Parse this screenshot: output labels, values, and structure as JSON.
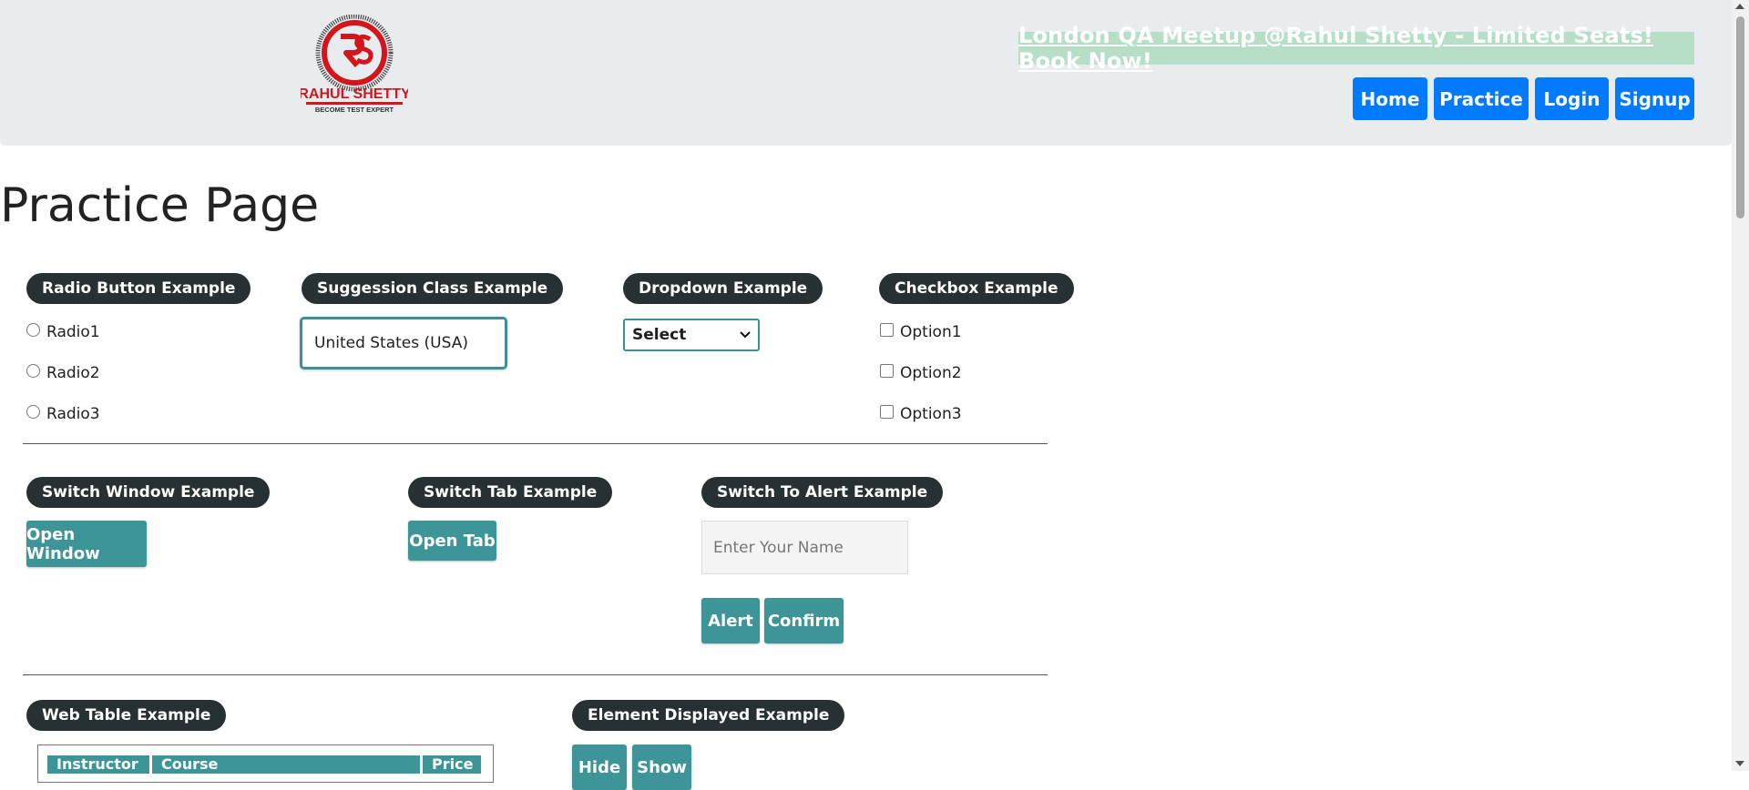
{
  "header": {
    "logo_text": "RAHUL SHETTY",
    "logo_tagline": "BECOME TEST EXPERT",
    "promo": "London QA Meetup @Rahul Shetty - Limited Seats! Book Now!",
    "nav": [
      "Home",
      "Practice",
      "Login",
      "Signup"
    ]
  },
  "page_title": "Practice Page",
  "radio": {
    "legend": "Radio Button Example",
    "options": [
      "Radio1",
      "Radio2",
      "Radio3"
    ]
  },
  "suggestion": {
    "legend": "Suggession Class Example",
    "value": "United States (USA)"
  },
  "dropdown": {
    "legend": "Dropdown Example",
    "selected": "Select"
  },
  "checkbox": {
    "legend": "Checkbox Example",
    "options": [
      "Option1",
      "Option2",
      "Option3"
    ]
  },
  "switch_window": {
    "legend": "Switch Window Example",
    "button": "Open Window"
  },
  "switch_tab": {
    "legend": "Switch Tab Example",
    "button": "Open Tab"
  },
  "alert": {
    "legend": "Switch To Alert Example",
    "placeholder": "Enter Your Name",
    "alert_button": "Alert",
    "confirm_button": "Confirm"
  },
  "web_table": {
    "legend": "Web Table Example",
    "headers": [
      "Instructor",
      "Course",
      "Price"
    ]
  },
  "element_displayed": {
    "legend": "Element Displayed Example",
    "hide_button": "Hide",
    "show_button": "Show"
  },
  "colors": {
    "nav_blue": "#007bff",
    "teal": "#3d9598",
    "legend_bg": "#273134",
    "header_bg": "#e9ecef"
  }
}
